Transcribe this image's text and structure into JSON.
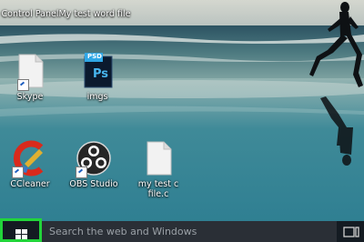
{
  "desktop": {
    "top_row": [
      "Control Panel",
      "My test word file"
    ],
    "icons": [
      {
        "label": "Skype",
        "icon": "blank-file-icon",
        "shortcut": true
      },
      {
        "label": "imgs",
        "icon": "photoshop-psd-icon",
        "badge": "PSD",
        "letters": "Ps",
        "shortcut": false
      },
      {
        "label": "CCleaner",
        "icon": "ccleaner-icon",
        "shortcut": true
      },
      {
        "label": "OBS Studio",
        "icon": "obs-studio-icon",
        "shortcut": true
      },
      {
        "label": "my test c file.c",
        "icon": "blank-file-icon",
        "shortcut": false
      }
    ]
  },
  "taskbar": {
    "search_placeholder": "Search the web and Windows",
    "start_icon": "windows-logo-icon",
    "highlight_color": "#22d43a"
  }
}
